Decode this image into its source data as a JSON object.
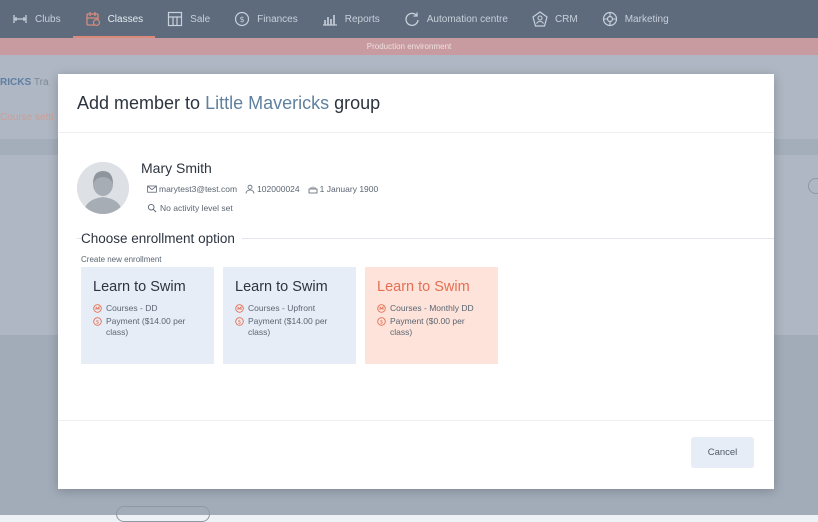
{
  "nav": {
    "items": [
      {
        "label": "Clubs",
        "icon": "clubs-icon"
      },
      {
        "label": "Classes",
        "icon": "classes-icon",
        "active": true
      },
      {
        "label": "Sale",
        "icon": "sale-icon"
      },
      {
        "label": "Finances",
        "icon": "finances-icon"
      },
      {
        "label": "Reports",
        "icon": "reports-icon"
      },
      {
        "label": "Automation centre",
        "icon": "automation-icon"
      },
      {
        "label": "CRM",
        "icon": "crm-icon"
      },
      {
        "label": "Marketing",
        "icon": "marketing-icon"
      }
    ]
  },
  "env_banner": "Production environment",
  "background": {
    "breadcrumb_group": "RICKS",
    "breadcrumb_rest": "Tra",
    "course_settings_link": "Course setti"
  },
  "modal": {
    "title_prefix": "Add member to",
    "group_name": "Little Mavericks",
    "title_suffix": "group",
    "member": {
      "name": "Mary Smith",
      "email": "marytest3@test.com",
      "member_id": "102000024",
      "birth_date": "1 January 1900",
      "activity_level": "No activity level set"
    },
    "section_title": "Choose enrollment option",
    "section_subtitle": "Create new enrollment",
    "options": [
      {
        "title": "Learn to Swim",
        "course": "Courses - DD",
        "payment": "Payment ($14.00 per class)",
        "selected": false
      },
      {
        "title": "Learn to Swim",
        "course": "Courses - Upfront",
        "payment": "Payment ($14.00 per class)",
        "selected": false
      },
      {
        "title": "Learn to Swim",
        "course": "Courses - Monthly DD",
        "payment": "Payment ($0.00 per class)",
        "selected": true
      }
    ],
    "cancel_label": "Cancel"
  },
  "colors": {
    "nav_bg": "#5d6b7d",
    "env_banner": "#c79b9f",
    "group_link": "#60809f",
    "selected_card_bg": "#fde3da",
    "selected_card_title": "#e56f53",
    "card_bg": "#e6edf6",
    "option_icon": "#e56f53"
  }
}
